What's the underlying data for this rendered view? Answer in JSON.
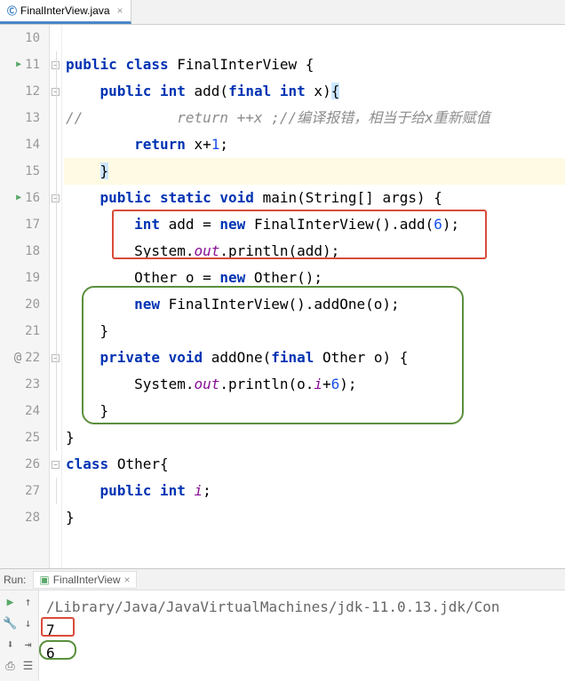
{
  "tab": {
    "name": "FinalInterView.java"
  },
  "gutter": {
    "lines": [
      "10",
      "11",
      "12",
      "13",
      "14",
      "15",
      "16",
      "17",
      "18",
      "19",
      "20",
      "21",
      "22",
      "23",
      "24",
      "25",
      "26",
      "27",
      "28"
    ],
    "runMarkers": [
      11,
      16
    ],
    "overrideMarker": 22
  },
  "code": {
    "l10": "",
    "l11_k1": "public",
    "l11_k2": "class",
    "l11_c": "FinalInterView",
    "l12_k1": "public",
    "l12_k2": "int",
    "l12_m": "add",
    "l12_k3": "final",
    "l12_k4": "int",
    "l12_p": "x",
    "l13_c": "//           return ++x ;//编译报错，相当于给x重新赋值",
    "l14_k": "return",
    "l14_e": "x+",
    "l14_n": "1",
    "l14_s": ";",
    "l15": "}",
    "l16_k1": "public",
    "l16_k2": "static",
    "l16_k3": "void",
    "l16_m": "main",
    "l16_a": "(String[] args) {",
    "l17_k1": "int",
    "l17_v": "add = ",
    "l17_k2": "new",
    "l17_c": "FinalInterView().add(",
    "l17_n": "6",
    "l17_e": ");",
    "l18_a": "System.",
    "l18_f": "out",
    "l18_b": ".println(add);",
    "l19_a": "Other o = ",
    "l19_k": "new",
    "l19_b": " Other();",
    "l20_k": "new",
    "l20_a": " FinalInterView().addOne(o);",
    "l21": "}",
    "l22_k1": "private",
    "l22_k2": "void",
    "l22_m": "addOne",
    "l22_k3": "final",
    "l22_a": "Other o) {",
    "l23_a": "System.",
    "l23_f": "out",
    "l23_b": ".println(o.",
    "l23_fi": "i",
    "l23_c": "+",
    "l23_n": "6",
    "l23_d": ");",
    "l24": "}",
    "l25": "}",
    "l26_k": "class",
    "l26_c": "Other{",
    "l27_k1": "public",
    "l27_k2": "int",
    "l27_v": "i",
    "l28": "}"
  },
  "console": {
    "runLabel": "Run:",
    "configName": "FinalInterView",
    "pathLine": "/Library/Java/JavaVirtualMachines/jdk-11.0.13.jdk/Con",
    "out1": "7",
    "out2": "6"
  }
}
